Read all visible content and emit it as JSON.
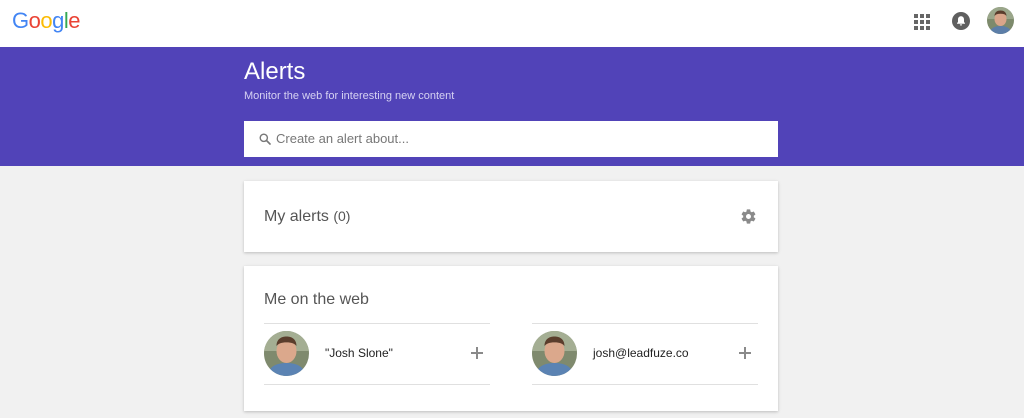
{
  "header": {
    "logo_letters": [
      {
        "char": "G",
        "color": "#4285F4"
      },
      {
        "char": "o",
        "color": "#EA4335"
      },
      {
        "char": "o",
        "color": "#FBBC05"
      },
      {
        "char": "g",
        "color": "#4285F4"
      },
      {
        "char": "l",
        "color": "#34A853"
      },
      {
        "char": "e",
        "color": "#EA4335"
      }
    ],
    "icons": [
      "apps-icon",
      "notifications-icon",
      "account-avatar"
    ]
  },
  "banner": {
    "title": "Alerts",
    "subtitle": "Monitor the web for interesting new content",
    "color": "#5143B8"
  },
  "search": {
    "placeholder": "Create an alert about...",
    "value": ""
  },
  "my_alerts": {
    "title": "My alerts",
    "count": "(0)",
    "settings_icon": "gear-icon"
  },
  "me_on_web": {
    "title": "Me on the web",
    "items": [
      {
        "label": "\"Josh Slone\"",
        "action_icon": "plus-icon"
      },
      {
        "label": "josh@leadfuze.co",
        "action_icon": "plus-icon"
      }
    ]
  }
}
